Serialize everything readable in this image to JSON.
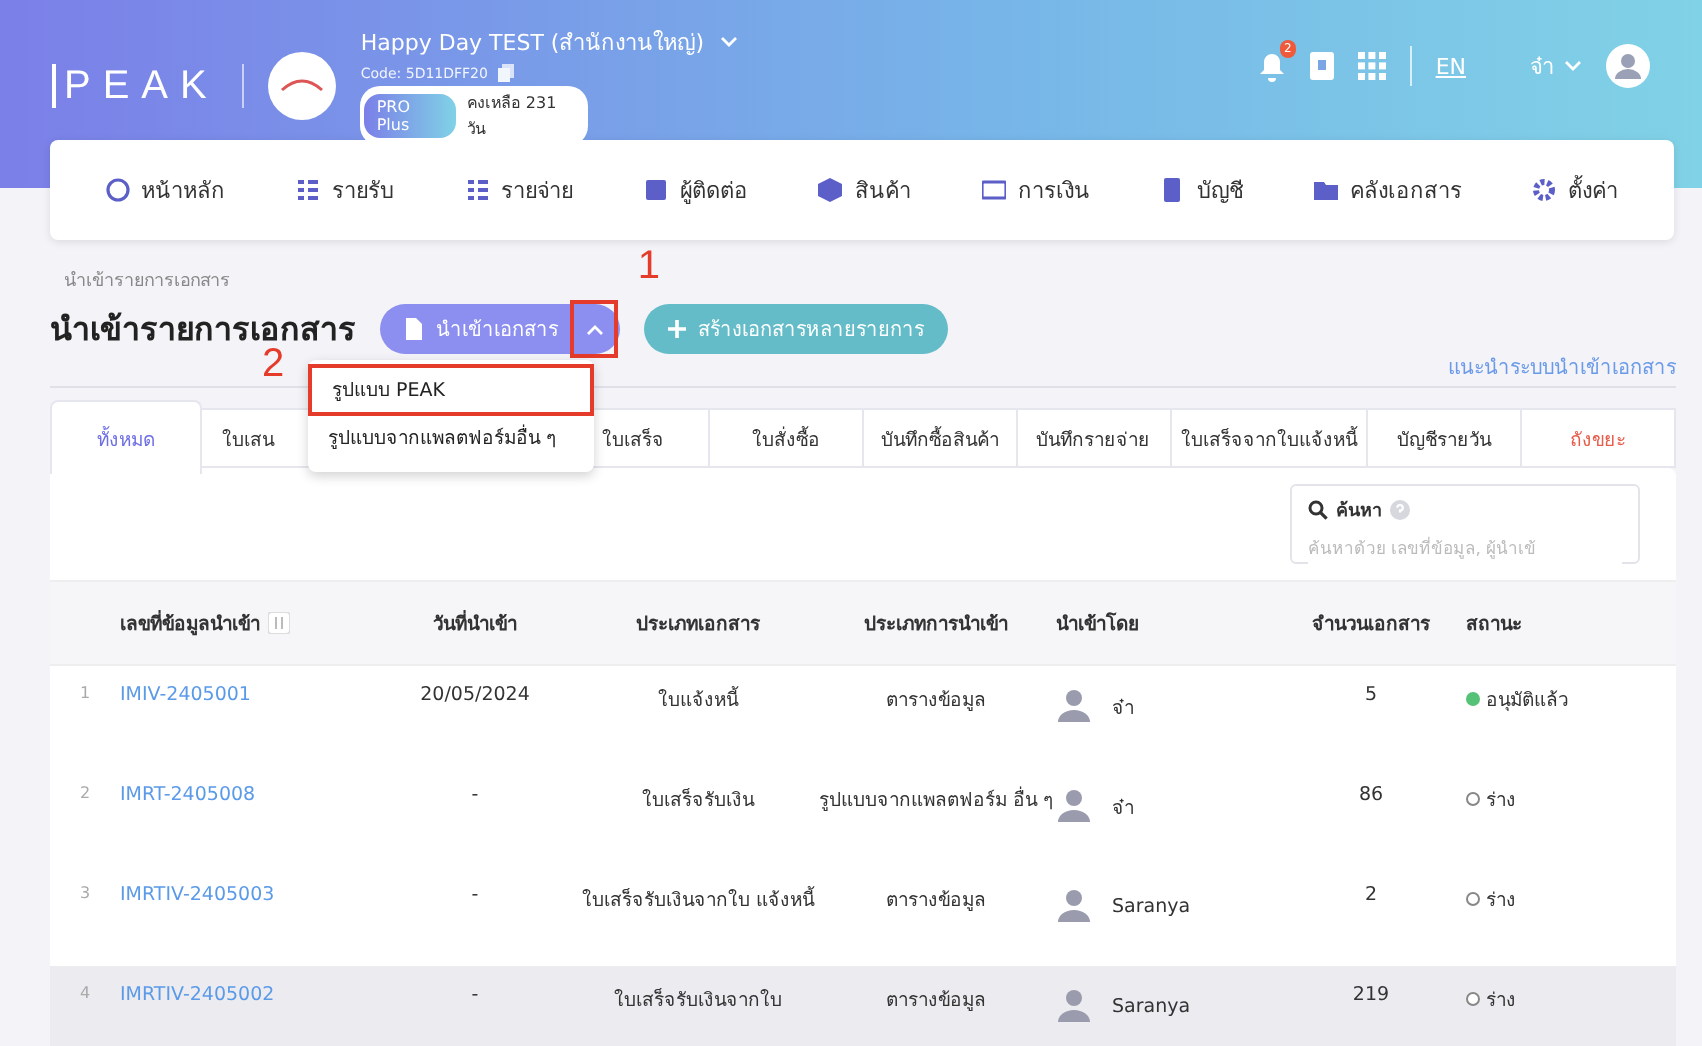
{
  "header": {
    "logo": "PEAK",
    "company": "Happy Day TEST (สำนักงานใหญ่)",
    "code": "Code: 5D11DFF20",
    "plan": "PRO Plus",
    "remaining": "คงเหลือ 231 วัน",
    "notifications": "2",
    "language": "EN",
    "user": "จ๋า"
  },
  "nav": [
    {
      "label": "หน้าหลัก"
    },
    {
      "label": "รายรับ"
    },
    {
      "label": "รายจ่าย"
    },
    {
      "label": "ผู้ติดต่อ"
    },
    {
      "label": "สินค้า"
    },
    {
      "label": "การเงิน"
    },
    {
      "label": "บัญชี"
    },
    {
      "label": "คลังเอกสาร"
    },
    {
      "label": "ตั้งค่า"
    }
  ],
  "breadcrumb": "นำเข้ารายการเอกสาร",
  "title": "นำเข้ารายการเอกสาร",
  "import_button": {
    "label": "นำเข้าเอกสาร",
    "expanded": true
  },
  "create_button": "สร้างเอกสารหลายรายการ",
  "guide_link": "แนะนำระบบนำเข้าเอกสาร",
  "dropdown": [
    {
      "label": "รูปแบบ PEAK",
      "highlighted": true
    },
    {
      "label": "รูปแบบจากแพลตฟอร์มอื่น ๆ",
      "highlighted": false
    }
  ],
  "annotations": [
    {
      "label": "1"
    },
    {
      "label": "2"
    }
  ],
  "tabs": [
    {
      "label": "ทั้งหมด",
      "selected": true,
      "kind": "normal"
    },
    {
      "label": "ใบเสน",
      "selected": false,
      "kind": "normal"
    },
    {
      "label": "ใบเสร็จ",
      "selected": false,
      "kind": "normal"
    },
    {
      "label": "ใบสั่งซื้อ",
      "selected": false,
      "kind": "normal"
    },
    {
      "label": "บันทึกซื้อสินค้า",
      "selected": false,
      "kind": "normal"
    },
    {
      "label": "บันทึกรายจ่าย",
      "selected": false,
      "kind": "normal"
    },
    {
      "label": "ใบเสร็จจากใบแจ้งหนี้",
      "selected": false,
      "kind": "normal"
    },
    {
      "label": "บัญชีรายวัน",
      "selected": false,
      "kind": "normal"
    },
    {
      "label": "ถังขยะ",
      "selected": false,
      "kind": "trash"
    }
  ],
  "search": {
    "label": "ค้นหา",
    "placeholder": "ค้นหาด้วย เลขที่ข้อมูล, ผู้นำเข้"
  },
  "table": {
    "columns": [
      "เลขที่ข้อมูลนำเข้า",
      "วันที่นำเข้า",
      "ประเภทเอกสาร",
      "ประเภทการนำเข้า",
      "นำเข้าโดย",
      "จำนวนเอกสาร",
      "สถานะ"
    ],
    "rows": [
      {
        "index": "1",
        "number": "IMIV-2405001",
        "date": "20/05/2024",
        "doc_type": "ใบแจ้งหนี้",
        "import_type": "ตารางข้อมูล",
        "by": "จ๋า",
        "count": "5",
        "status": "อนุมัติแล้ว",
        "color": "#55c277",
        "filled": true,
        "hovered": false
      },
      {
        "index": "2",
        "number": "IMRT-2405008",
        "date": "-",
        "doc_type": "ใบเสร็จรับเงิน",
        "import_type": "รูปแบบจากแพลตฟอร์ม อื่น ๆ",
        "by": "จ๋า",
        "count": "86",
        "status": "ร่าง",
        "color": "#888888",
        "filled": false,
        "hovered": false
      },
      {
        "index": "3",
        "number": "IMRTIV-2405003",
        "date": "-",
        "doc_type": "ใบเสร็จรับเงินจากใบ แจ้งหนี้",
        "import_type": "ตารางข้อมูล",
        "by": "Saranya",
        "count": "2",
        "status": "ร่าง",
        "color": "#888888",
        "filled": false,
        "hovered": false
      },
      {
        "index": "4",
        "number": "IMRTIV-2405002",
        "date": "-",
        "doc_type": "ใบเสร็จรับเงินจากใบ",
        "import_type": "ตารางข้อมูล",
        "by": "Saranya",
        "count": "219",
        "status": "ร่าง",
        "color": "#888888",
        "filled": false,
        "hovered": true
      }
    ]
  }
}
